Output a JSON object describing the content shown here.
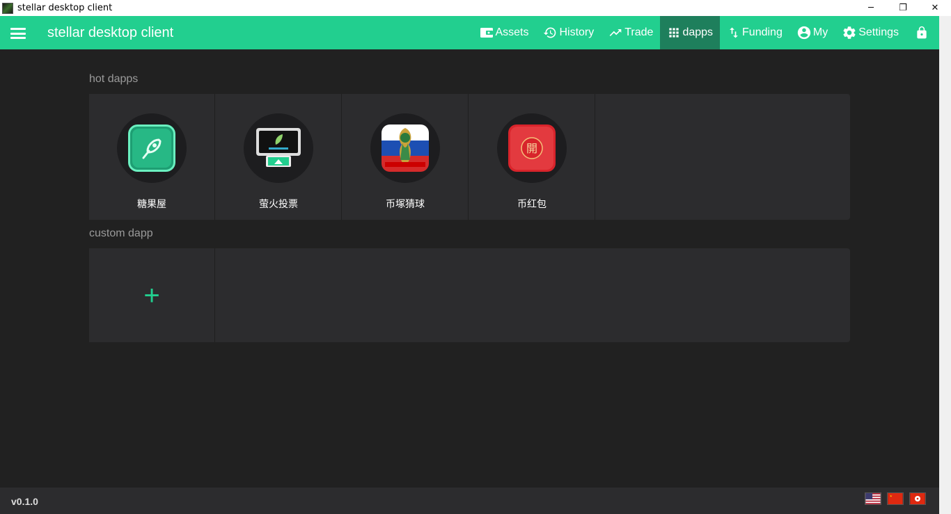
{
  "window": {
    "title": "stellar desktop client",
    "minimize_glyph": "─",
    "restore_glyph": "❐",
    "close_glyph": "✕"
  },
  "appbar": {
    "title": "stellar desktop client",
    "nav": [
      {
        "label": "Assets",
        "icon": "wallet-icon"
      },
      {
        "label": "History",
        "icon": "history-icon"
      },
      {
        "label": "Trade",
        "icon": "trending-up-icon"
      },
      {
        "label": "dapps",
        "icon": "apps-grid-icon",
        "active": true
      },
      {
        "label": "Funding",
        "icon": "swap-vertical-icon"
      },
      {
        "label": "My",
        "icon": "account-circle-icon"
      },
      {
        "label": "Settings",
        "icon": "gear-icon"
      },
      {
        "label": "",
        "icon": "lock-icon"
      }
    ]
  },
  "hot_dapps": {
    "label": "hot dapps",
    "items": [
      {
        "name": "糖果屋",
        "icon": "candy-house-icon"
      },
      {
        "name": "萤火投票",
        "icon": "firefly-vote-icon"
      },
      {
        "name": "币塚猜球",
        "icon": "world-cup-icon"
      },
      {
        "name": "币红包",
        "icon": "red-envelope-icon"
      }
    ]
  },
  "custom_dapp": {
    "label": "custom dapp",
    "add_glyph": "+"
  },
  "footer": {
    "version": "v0.1.0",
    "languages": [
      "us-flag-icon",
      "cn-flag-icon",
      "hk-flag-icon"
    ]
  },
  "colors": {
    "accent": "#22cf8f",
    "accent_dark": "#1e7f5c",
    "background": "#212121",
    "panel": "#2c2c2e"
  }
}
